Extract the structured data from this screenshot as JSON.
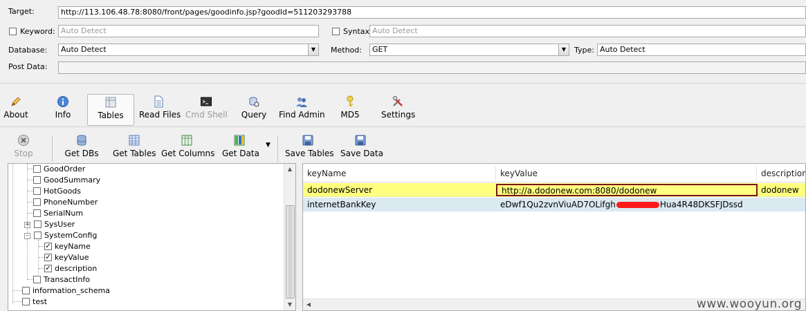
{
  "form": {
    "target_label": "Target:",
    "target_value": "http://113.106.48.78:8080/front/pages/goodinfo.jsp?goodId=511203293788",
    "keyword_label": "Keyword:",
    "keyword_placeholder": "Auto Detect",
    "syntax_label": "Syntax:",
    "syntax_placeholder": "Auto Detect",
    "database_label": "Database:",
    "database_value": "Auto Detect",
    "method_label": "Method:",
    "method_value": "GET",
    "type_label": "Type:",
    "type_value": "Auto Detect",
    "postdata_label": "Post Data:"
  },
  "toolbar": {
    "items": [
      {
        "label": "About",
        "icon": "pen-icon",
        "color": "#e2a33a"
      },
      {
        "label": "Info",
        "icon": "info-icon",
        "color": "#3a72c4"
      },
      {
        "label": "Tables",
        "icon": "table-icon",
        "color": "#9aa6b6"
      },
      {
        "label": "Read Files",
        "icon": "document-icon",
        "color": "#5b7fb8"
      },
      {
        "label": "Cmd Shell",
        "icon": "terminal-icon",
        "color": "#222222"
      },
      {
        "label": "Query",
        "icon": "query-icon",
        "color": "#4f6fa8"
      },
      {
        "label": "Find Admin",
        "icon": "users-icon",
        "color": "#4b6db0"
      },
      {
        "label": "MD5",
        "icon": "key-icon",
        "color": "#d7b52a"
      },
      {
        "label": "Settings",
        "icon": "tools-icon",
        "color": "#c9362f"
      }
    ]
  },
  "subtoolbar": {
    "stop": "Stop",
    "get_dbs": "Get DBs",
    "get_tables": "Get Tables",
    "get_columns": "Get Columns",
    "get_data": "Get Data",
    "save_tables": "Save Tables",
    "save_data": "Save Data"
  },
  "tree": {
    "tables": [
      "GoodOrder",
      "GoodSummary",
      "HotGoods",
      "PhoneNumber",
      "SerialNum",
      "SysUser",
      "SystemConfig"
    ],
    "columns": [
      "keyName",
      "keyValue",
      "description"
    ],
    "after": "TransactInfo",
    "databases": [
      "information_schema",
      "test"
    ]
  },
  "grid": {
    "headers": [
      "keyName",
      "keyValue",
      "description"
    ],
    "rows": [
      [
        "dodonewServer",
        "http://a.dodonew.com:8080/dodonew",
        "dodonew"
      ],
      [
        "internetBankKey",
        "eDwf1Qu2zvnViuAD7OLifgh",
        "Hua4R48DKSFJDssd"
      ]
    ]
  },
  "watermark": "www.wooyun.org"
}
